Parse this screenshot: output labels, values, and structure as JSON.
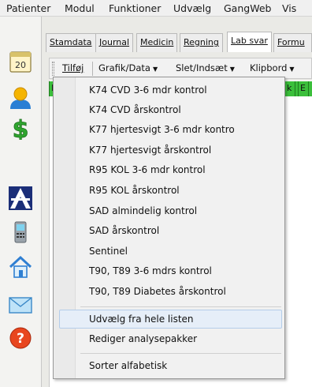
{
  "menubar": {
    "items": [
      "Patienter",
      "Modul",
      "Funktioner",
      "Udvælg",
      "GangWeb",
      "Vis"
    ]
  },
  "sidebar": {
    "icons": [
      "calendar-icon",
      "person-icon",
      "dollar-icon",
      "network-icon",
      "phone-icon",
      "home-icon",
      "mail-icon",
      "help-icon"
    ],
    "calendar_number": "20",
    "help_glyph": "?"
  },
  "tabs": [
    "Stamdata",
    "Journal",
    "Medicin",
    "Regning",
    "Lab svar",
    "Formu"
  ],
  "toolbar": {
    "items": [
      "Tilføj",
      "Grafik/Data",
      "Slet/Indsæt",
      "Klipbord"
    ]
  },
  "grid": {
    "left_cell": "P",
    "right_cells": [
      "k",
      "E"
    ]
  },
  "dropdown": {
    "items": [
      "K74 CVD 3-6 mdr kontrol",
      "K74 CVD årskontrol",
      "K77 hjertesvigt 3-6 mdr kontro",
      "K77 hjertesvigt årskontrol",
      "R95 KOL 3-6 mdr kontrol",
      "R95 KOL årskontrol",
      "SAD almindelig kontrol",
      "SAD årskontrol",
      "Sentinel",
      "T90, T89 3-6 mdrs kontrol",
      "T90, T89 Diabetes årskontrol"
    ],
    "actions": [
      "Udvælg fra hele listen",
      "Rediger analysepakker"
    ],
    "sort": "Sorter alfabetisk"
  },
  "colors": {
    "grid_green": "#3bbf3b",
    "highlight": "#e6eef8"
  }
}
